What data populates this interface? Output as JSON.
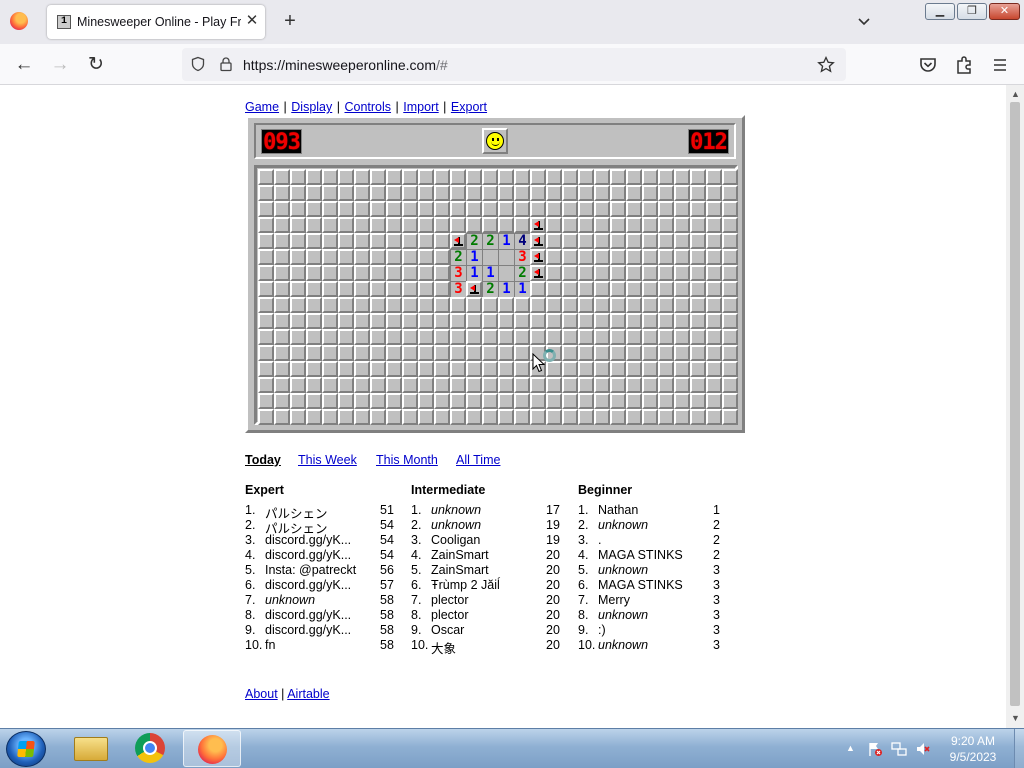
{
  "browser": {
    "tab_title": "Minesweeper Online - Play Free Online",
    "tab_favicon_text": "1",
    "new_tab_label": "+",
    "url_host": "https://minesweeperonline.com",
    "url_path": "/#"
  },
  "menu": {
    "items": [
      "Game",
      "Display",
      "Controls",
      "Import",
      "Export"
    ],
    "separator": "|"
  },
  "game": {
    "mines_left": "093",
    "timer": "012",
    "columns": 30,
    "rows": 16,
    "revealed": [
      {
        "r": 3,
        "c": 17,
        "v": "1"
      },
      {
        "r": 4,
        "c": 12,
        "v": "1"
      },
      {
        "r": 4,
        "c": 13,
        "v": "2"
      },
      {
        "r": 4,
        "c": 14,
        "v": "2"
      },
      {
        "r": 4,
        "c": 15,
        "v": "1"
      },
      {
        "r": 4,
        "c": 16,
        "v": "4"
      },
      {
        "r": 4,
        "c": 17,
        "v": "1"
      },
      {
        "r": 5,
        "c": 12,
        "v": "2"
      },
      {
        "r": 5,
        "c": 13,
        "v": "1"
      },
      {
        "r": 5,
        "c": 14,
        "v": ""
      },
      {
        "r": 5,
        "c": 15,
        "v": ""
      },
      {
        "r": 5,
        "c": 16,
        "v": "3"
      },
      {
        "r": 5,
        "c": 17,
        "v": "1"
      },
      {
        "r": 6,
        "c": 12,
        "v": "3"
      },
      {
        "r": 6,
        "c": 13,
        "v": "1"
      },
      {
        "r": 6,
        "c": 14,
        "v": "1"
      },
      {
        "r": 6,
        "c": 15,
        "v": ""
      },
      {
        "r": 6,
        "c": 16,
        "v": "2"
      },
      {
        "r": 6,
        "c": 17,
        "v": "1"
      },
      {
        "r": 7,
        "c": 12,
        "v": "3"
      },
      {
        "r": 7,
        "c": 13,
        "v": "1"
      },
      {
        "r": 7,
        "c": 14,
        "v": "2"
      },
      {
        "r": 7,
        "c": 15,
        "v": "1"
      },
      {
        "r": 7,
        "c": 16,
        "v": "1"
      }
    ],
    "flags": [
      {
        "r": 3,
        "c": 17
      },
      {
        "r": 4,
        "c": 12
      },
      {
        "r": 4,
        "c": 17
      },
      {
        "r": 5,
        "c": 17
      },
      {
        "r": 6,
        "c": 17
      },
      {
        "r": 7,
        "c": 13
      }
    ]
  },
  "scores": {
    "periods": [
      "Today",
      "This Week",
      "This Month",
      "All Time"
    ],
    "expert": {
      "title": "Expert",
      "rows": [
        {
          "rank": "1.",
          "name": "パルシェン",
          "time": "51",
          "italic": false
        },
        {
          "rank": "2.",
          "name": "パルシェン",
          "time": "54",
          "italic": false
        },
        {
          "rank": "3.",
          "name": "discord.gg/yK...",
          "time": "54",
          "italic": false
        },
        {
          "rank": "4.",
          "name": "discord.gg/yK...",
          "time": "54",
          "italic": false
        },
        {
          "rank": "5.",
          "name": "Insta: @patreckt",
          "time": "56",
          "italic": false
        },
        {
          "rank": "6.",
          "name": "discord.gg/yK...",
          "time": "57",
          "italic": false
        },
        {
          "rank": "7.",
          "name": "unknown",
          "time": "58",
          "italic": true
        },
        {
          "rank": "8.",
          "name": "discord.gg/yK...",
          "time": "58",
          "italic": false
        },
        {
          "rank": "9.",
          "name": "discord.gg/yK...",
          "time": "58",
          "italic": false
        },
        {
          "rank": "10.",
          "name": "fn",
          "time": "58",
          "italic": false
        }
      ]
    },
    "intermediate": {
      "title": "Intermediate",
      "rows": [
        {
          "rank": "1.",
          "name": "unknown",
          "time": "17",
          "italic": true
        },
        {
          "rank": "2.",
          "name": "unknown",
          "time": "19",
          "italic": true
        },
        {
          "rank": "3.",
          "name": "Cooligan",
          "time": "19",
          "italic": false
        },
        {
          "rank": "4.",
          "name": "ZainSmart",
          "time": "20",
          "italic": false
        },
        {
          "rank": "5.",
          "name": "ZainSmart",
          "time": "20",
          "italic": false
        },
        {
          "rank": "6.",
          "name": "Ŧrùmp 2 Jăiĺ",
          "time": "20",
          "italic": false
        },
        {
          "rank": "7.",
          "name": "plector",
          "time": "20",
          "italic": false
        },
        {
          "rank": "8.",
          "name": "plector",
          "time": "20",
          "italic": false
        },
        {
          "rank": "9.",
          "name": "Oscar",
          "time": "20",
          "italic": false
        },
        {
          "rank": "10.",
          "name": "大象",
          "time": "20",
          "italic": false
        }
      ]
    },
    "beginner": {
      "title": "Beginner",
      "rows": [
        {
          "rank": "1.",
          "name": "Nathan",
          "time": "1",
          "italic": false
        },
        {
          "rank": "2.",
          "name": "unknown",
          "time": "2",
          "italic": true
        },
        {
          "rank": "3.",
          "name": ".",
          "time": "2",
          "italic": false
        },
        {
          "rank": "4.",
          "name": "MAGA STINKS",
          "time": "2",
          "italic": false
        },
        {
          "rank": "5.",
          "name": "unknown",
          "time": "3",
          "italic": true
        },
        {
          "rank": "6.",
          "name": "MAGA STINKS",
          "time": "3",
          "italic": false
        },
        {
          "rank": "7.",
          "name": "Merry",
          "time": "3",
          "italic": false
        },
        {
          "rank": "8.",
          "name": "unknown",
          "time": "3",
          "italic": true
        },
        {
          "rank": "9.",
          "name": ":)",
          "time": "3",
          "italic": false
        },
        {
          "rank": "10.",
          "name": "unknown",
          "time": "3",
          "italic": true
        }
      ]
    }
  },
  "footer": {
    "about": "About",
    "separator": "|",
    "airtable": "Airtable"
  },
  "taskbar": {
    "time": "9:20 AM",
    "date": "9/5/2023"
  },
  "colors": {
    "link": "#0000cc",
    "board_gray": "#c0c0c0",
    "counter_red": "#ee0000",
    "n1": "#0000ff",
    "n2": "#007b00",
    "n3": "#ff0000",
    "n4": "#00007b"
  }
}
